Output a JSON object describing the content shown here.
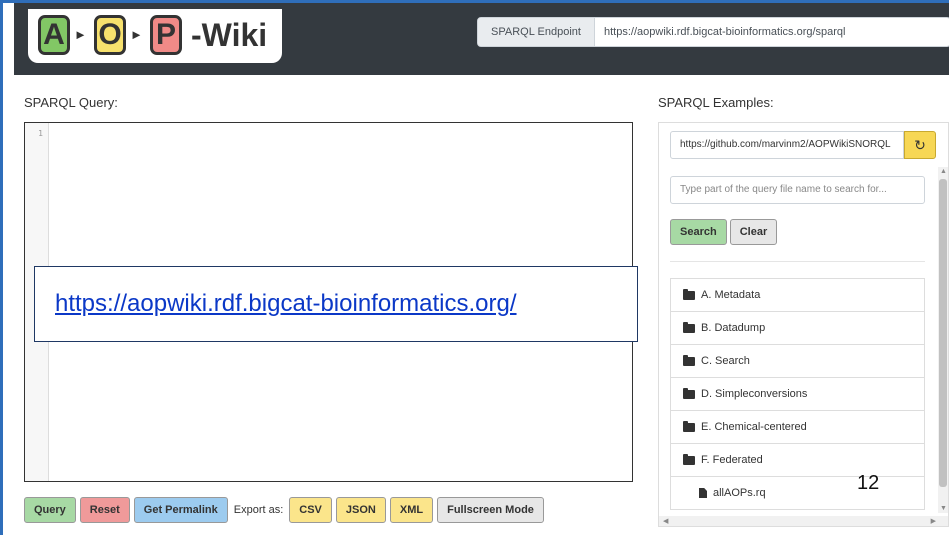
{
  "header": {
    "logo": {
      "letters": [
        "A",
        "O",
        "P"
      ],
      "arrow": "►",
      "suffix": "-Wiki",
      "colors": {
        "A": "#82c765",
        "O": "#f7e16d",
        "P": "#f08a87"
      }
    },
    "endpoint": {
      "label": "SPARQL Endpoint",
      "value": "https://aopwiki.rdf.bigcat-bioinformatics.org/sparql"
    }
  },
  "query": {
    "title": "SPARQL Query:",
    "line_numbers": [
      "1"
    ],
    "overlay_link": "https://aopwiki.rdf.bigcat-bioinformatics.org/"
  },
  "buttons": {
    "query": "Query",
    "reset": "Reset",
    "permalink": "Get Permalink",
    "export_label": "Export as:",
    "csv": "CSV",
    "json": "JSON",
    "xml": "XML",
    "fullscreen": "Fullscreen Mode"
  },
  "examples": {
    "title": "SPARQL Examples:",
    "repo_url": "https://github.com/marvinm2/AOPWikiSNORQL",
    "refresh_icon": "refresh-icon",
    "search_placeholder": "Type part of the query file name to search for...",
    "search_label": "Search",
    "clear_label": "Clear",
    "folders": [
      {
        "label": "A. Metadata"
      },
      {
        "label": "B. Datadump"
      },
      {
        "label": "C. Search"
      },
      {
        "label": "D. Simpleconversions"
      },
      {
        "label": "E. Chemical-centered"
      },
      {
        "label": "F. Federated"
      }
    ],
    "files": [
      {
        "label": "allAOPs.rq"
      }
    ]
  },
  "slide_number": "12",
  "colors": {
    "header_bg": "#343a40",
    "frame": "#2f6eba",
    "green": "#a7d9a4",
    "red": "#f09a9a",
    "blue": "#9ccbef",
    "yellow": "#fbe58b"
  }
}
